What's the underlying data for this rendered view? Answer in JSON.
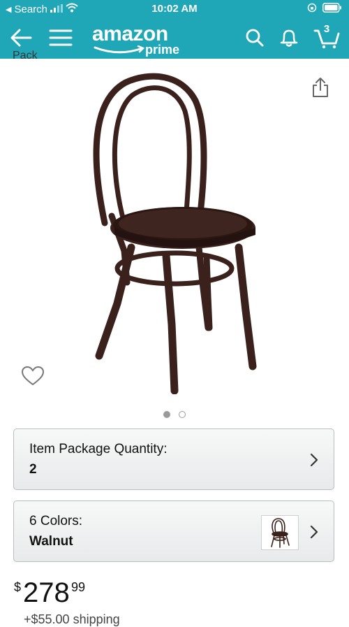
{
  "status_bar": {
    "back_app": "Search",
    "time": "10:02 AM"
  },
  "nav": {
    "logo_text": "amazon",
    "logo_sub": "prime",
    "cart_count": "3"
  },
  "product": {
    "title_fragment": "Pack",
    "image_count": 2,
    "active_image_index": 0
  },
  "options": {
    "package_quantity": {
      "label": "Item Package Quantity:",
      "value": "2"
    },
    "color": {
      "label": "6 Colors:",
      "value": "Walnut"
    }
  },
  "price": {
    "currency": "$",
    "whole": "278",
    "fraction": "99"
  },
  "shipping": {
    "text": "+$55.00 shipping"
  },
  "colors": {
    "header_teal": "#1fa7b8",
    "chair_brown": "#3b211c"
  }
}
